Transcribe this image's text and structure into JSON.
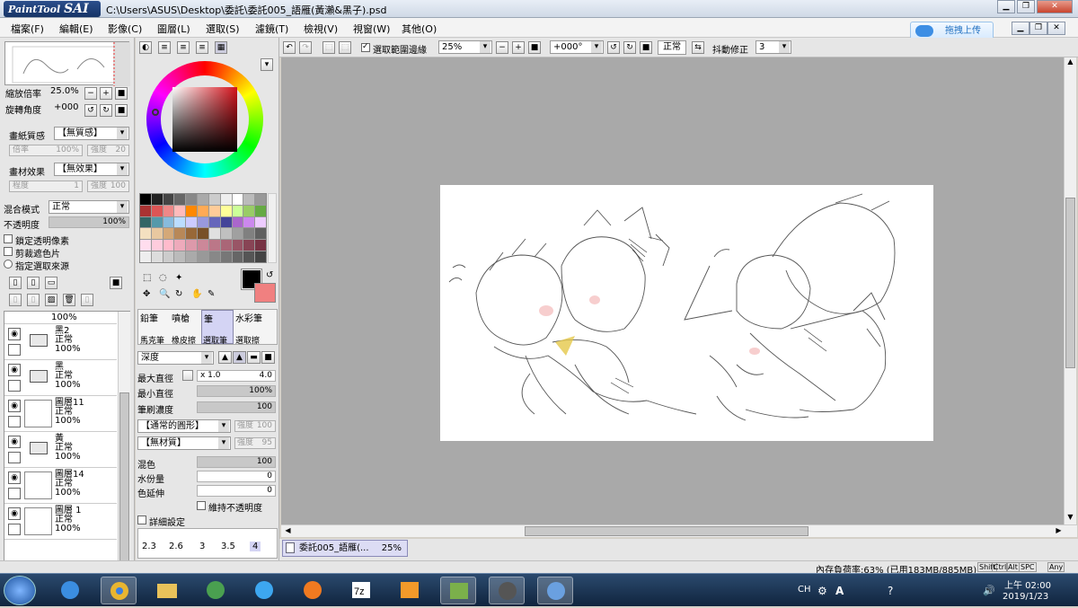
{
  "app": {
    "logo_top": "PaintTool",
    "logo_main": "SAI",
    "title": "C:\\Users\\ASUS\\Desktop\\委託\\委託005_語雁(黃瀨&黑子).psd",
    "upload_label": "拖拽上传"
  },
  "menu": [
    "檔案(F)",
    "編輯(E)",
    "影像(C)",
    "圖層(L)",
    "選取(S)",
    "濾鏡(T)",
    "檢視(V)",
    "視窗(W)",
    "其他(O)"
  ],
  "nav": {
    "zoom_label": "縮放倍率",
    "zoom_value": "25.0%",
    "rotate_label": "旋轉角度",
    "rotate_value": "+000"
  },
  "paper": {
    "texture_label": "畫紙質感",
    "texture_value": "【無質感】",
    "scale_label": "倍率",
    "scale_value": "100%",
    "strength_label": "強度",
    "strength_value": "20",
    "effect_label": "畫材效果",
    "effect_value": "【無效果】",
    "degree_label": "程度",
    "degree_value": "1",
    "strength2_label": "強度",
    "strength2_value": "100"
  },
  "blend": {
    "mode_label": "混合模式",
    "mode_value": "正常",
    "opacity_label": "不透明度",
    "opacity_value": "100%",
    "protect_label": "鎖定透明像素",
    "clip_label": "剪裁遮色片",
    "source_label": "指定選取來源"
  },
  "layers": [
    {
      "name": "",
      "mode": "",
      "opacity": "100%",
      "kind": "strip"
    },
    {
      "name": "黑2",
      "mode": "正常",
      "opacity": "100%",
      "kind": "folder"
    },
    {
      "name": "黑",
      "mode": "正常",
      "opacity": "100%",
      "kind": "folder"
    },
    {
      "name": "圖層11",
      "mode": "正常",
      "opacity": "100%",
      "kind": "layer"
    },
    {
      "name": "黃",
      "mode": "正常",
      "opacity": "100%",
      "kind": "folder"
    },
    {
      "name": "圖層14",
      "mode": "正常",
      "opacity": "100%",
      "kind": "layer"
    },
    {
      "name": "圖層 1",
      "mode": "正常",
      "opacity": "100%",
      "kind": "layer"
    }
  ],
  "tools": {
    "names": [
      "鉛筆",
      "噴槍",
      "筆",
      "水彩筆"
    ],
    "sub": [
      "馬克筆",
      "橡皮擦",
      "選取筆",
      "選取擦"
    ],
    "shape_label": "深度",
    "max_label": "最大直徑",
    "max_mult": "x 1.0",
    "max_value": "4.0",
    "min_label": "最小直徑",
    "min_value": "100%",
    "density_label": "筆刷濃度",
    "density_value": "100",
    "shape_value": "【通常的圓形】",
    "shape_strength_label": "強度",
    "shape_strength_value": "100",
    "texture_value": "【無材質】",
    "texture_strength_label": "強度",
    "texture_strength_value": "95",
    "mix_label": "混色",
    "mix_value": "100",
    "water_label": "水份量",
    "water_value": "0",
    "stretch_label": "色延伸",
    "stretch_value": "0",
    "keep_opacity_label": "維持不透明度",
    "detail_label": "詳細設定",
    "sizes": [
      "2.3",
      "2.6",
      "3",
      "3.5",
      "4"
    ]
  },
  "canvas_toolbar": {
    "select_edge_label": "選取範圍邊緣",
    "zoom_value": "25%",
    "angle_value": "+000°",
    "mode_value": "正常",
    "stabilizer_label": "抖動修正",
    "stabilizer_value": "3"
  },
  "doc_tab": {
    "name": "委託005_語雁(...",
    "zoom": "25%"
  },
  "status": {
    "memory": "內存負荷率:63% (已用183MB/885MB)",
    "keys": [
      "Shift",
      "Ctrl",
      "Alt",
      "SPC",
      "Any"
    ]
  },
  "taskbar": {
    "lang": "CH",
    "time": "上午 02:00",
    "date": "2019/1/23"
  },
  "colors": {
    "primary": "#000000",
    "secondary": "#f08080",
    "accent": "#d4121b"
  }
}
